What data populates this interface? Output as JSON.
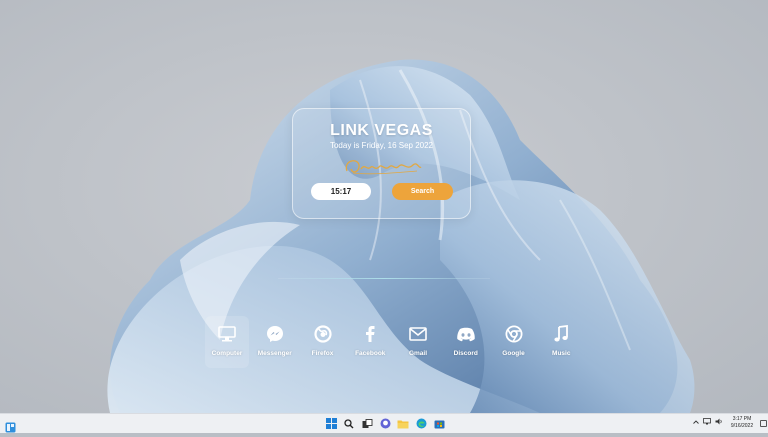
{
  "card": {
    "title": "LINK VEGAS",
    "date_text": "Today is Friday, 16 Sep 2022",
    "time_value": "15:17",
    "search_label": "Search"
  },
  "dock": {
    "items": [
      {
        "label": "Computer",
        "icon": "monitor-icon"
      },
      {
        "label": "Messenger",
        "icon": "messenger-icon"
      },
      {
        "label": "Firefox",
        "icon": "firefox-icon"
      },
      {
        "label": "Facebook",
        "icon": "facebook-icon"
      },
      {
        "label": "Gmail",
        "icon": "mail-icon"
      },
      {
        "label": "Discord",
        "icon": "discord-icon"
      },
      {
        "label": "Google",
        "icon": "chrome-icon"
      },
      {
        "label": "Music",
        "icon": "music-note-icon"
      }
    ]
  },
  "taskbar": {
    "time": "3:17 PM",
    "date": "9/16/2022"
  },
  "colors": {
    "search_button": "#eda43b",
    "taskbar": "#eef0f3",
    "signature": "#e2a842"
  }
}
